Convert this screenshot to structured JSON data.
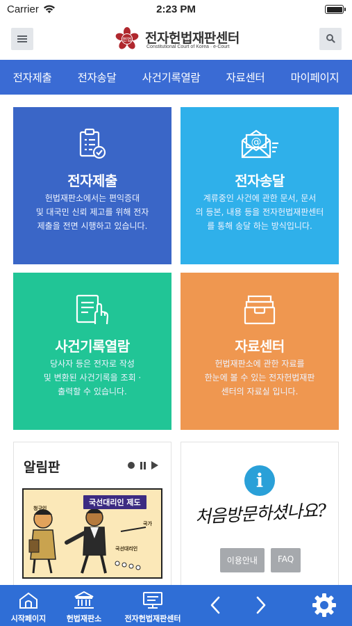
{
  "status_bar": {
    "carrier": "Carrier",
    "time": "2:23 PM"
  },
  "header": {
    "title": "전자헌법재판센터",
    "subtitle": "Constitutional Court of Korea · e-Court",
    "emblem_text": "헌법"
  },
  "nav": {
    "items": [
      "전자제출",
      "전자송달",
      "사건기록열람",
      "자료센터",
      "마이페이지"
    ]
  },
  "tiles": [
    {
      "title": "전자제출",
      "icon": "clipboard-check-icon",
      "color": "#3a66c7",
      "desc": [
        "헌법재판소에서는 편익증대",
        "및 대국민 신뢰 제고를 위해 전자",
        "제출을 전면 시행하고 있습니다."
      ]
    },
    {
      "title": "전자송달",
      "icon": "email-icon",
      "color": "#2fb0ea",
      "desc": [
        "계류중인 사건에 관한 문서, 문서",
        "의 등본, 내용 등을 전자헌법재판센터",
        "를 통해 송달 하는 방식입니다."
      ]
    },
    {
      "title": "사건기록열람",
      "icon": "document-hand-icon",
      "color": "#21c596",
      "desc": [
        "당사자 등은 전자로 작성",
        "및 변환된 사건기록을 조회 ·",
        "출력할 수 있습니다."
      ]
    },
    {
      "title": "자료센터",
      "icon": "archive-box-icon",
      "color": "#ef9750",
      "desc": [
        "헌법재판소에 관한 자료를",
        "한눈에 볼 수 있는 전자헌법재판",
        "센터의 자료실 입니다."
      ]
    }
  ],
  "notice": {
    "title": "알림판",
    "banner_tag": "국선대리인 제도",
    "banner_labels": [
      "청구인",
      "국가",
      "국선대리인"
    ]
  },
  "welcome": {
    "text": "처음방문하셨나요?",
    "guide_label": "이용안내",
    "faq_label": "FAQ"
  },
  "tabbar": {
    "home_label": "시작페이지",
    "court_label": "헌법재판소",
    "ecourt_label": "전자헌법재판센터"
  },
  "colors": {
    "nav": "#3a6bd4",
    "tabbar": "#2f6ed6",
    "info": "#2aa0d8",
    "emblem": "#b0282e"
  }
}
